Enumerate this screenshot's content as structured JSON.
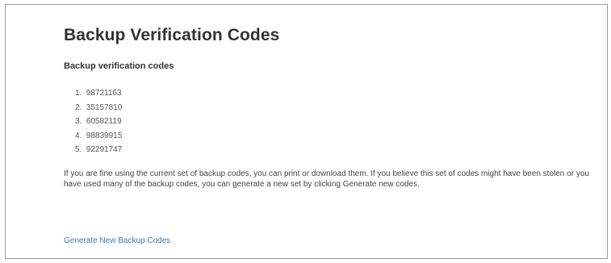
{
  "page": {
    "title": "Backup Verification Codes",
    "section_heading": "Backup verification codes"
  },
  "codes": [
    {
      "number": "1.",
      "code": "98721163"
    },
    {
      "number": "2.",
      "code": "35157810"
    },
    {
      "number": "3.",
      "code": "60582119"
    },
    {
      "number": "4.",
      "code": "98839915"
    },
    {
      "number": "5.",
      "code": "92291747"
    }
  ],
  "info_text": "If you are fine using the current set of backup codes, you can print or download them. If you believe this set of codes might have been stolen or you have used many of the backup codes, you can generate a new set by clicking Generate new codes.",
  "actions": {
    "generate_link": "Generate New Backup Codes"
  },
  "colors": {
    "link": "#3a79b0",
    "title": "#333333",
    "border": "#9a9a9a"
  }
}
